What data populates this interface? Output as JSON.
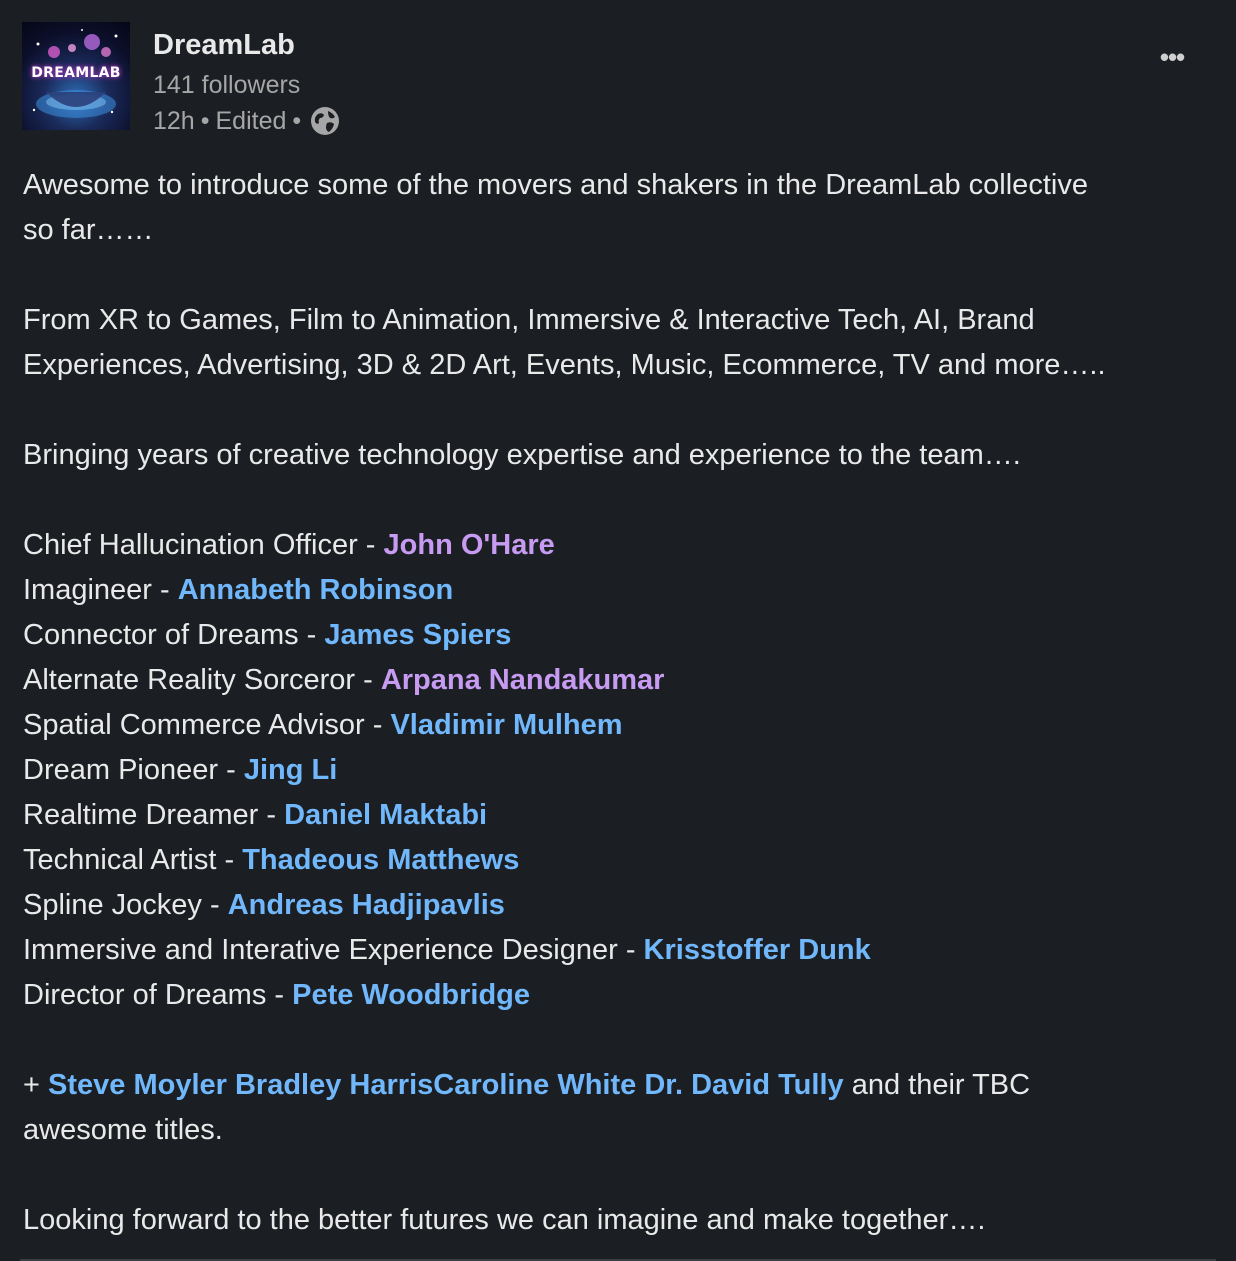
{
  "post": {
    "author": {
      "name": "DreamLab",
      "logo_text": "DREAMLAB",
      "followers": "141 followers",
      "time": "12h",
      "edited": "Edited",
      "separator": "•",
      "visibility_icon": "globe-icon"
    },
    "menu_icon": "more-options-icon",
    "menu_glyph": "•••",
    "intro_line1": "Awesome to introduce some of the movers and shakers in the DreamLab collective",
    "intro_line2": "so far……",
    "fields_line1": "From XR to Games, Film to Animation, Immersive & Interactive Tech, AI, Brand",
    "fields_line2": "Experiences, Advertising, 3D & 2D Art, Events, Music, Ecommerce, TV and more…..",
    "bringing": "Bringing years of creative technology expertise and experience to the team….",
    "roles": [
      {
        "title": "Chief Hallucination Officer - ",
        "name": "John O'Hare",
        "color": "#c79bf2"
      },
      {
        "title": "Imagineer - ",
        "name": "Annabeth Robinson",
        "color": "#71b7fb"
      },
      {
        "title": "Connector of Dreams - ",
        "name": "James Spiers",
        "color": "#71b7fb"
      },
      {
        "title": "Alternate Reality Sorceror - ",
        "name": "Arpana Nandakumar",
        "color": "#c79bf2"
      },
      {
        "title": "Spatial Commerce Advisor - ",
        "name": "Vladimir Mulhem",
        "color": "#71b7fb"
      },
      {
        "title": "Dream Pioneer - ",
        "name": "Jing Li",
        "color": "#71b7fb"
      },
      {
        "title": "Realtime Dreamer - ",
        "name": "Daniel Maktabi",
        "color": "#71b7fb"
      },
      {
        "title": "Technical Artist - ",
        "name": "Thadeous Matthews",
        "color": "#71b7fb"
      },
      {
        "title": "Spline Jockey - ",
        "name": "Andreas Hadjipavlis",
        "color": "#71b7fb"
      },
      {
        "title": "Immersive and Interative Experience Designer - ",
        "name": "Krisstoffer Dunk",
        "color": "#71b7fb"
      },
      {
        "title": "Director of Dreams - ",
        "name": "Pete Woodbridge",
        "color": "#71b7fb"
      }
    ],
    "plus_prefix": "+ ",
    "plus_names": [
      "Steve Moyler",
      "Bradley Harris",
      "Caroline White",
      "Dr. David Tully"
    ],
    "plus_suffix": " and their TBC",
    "plus_line2": "awesome titles.",
    "closing": "Looking forward to the better futures we can imagine and make together…."
  }
}
